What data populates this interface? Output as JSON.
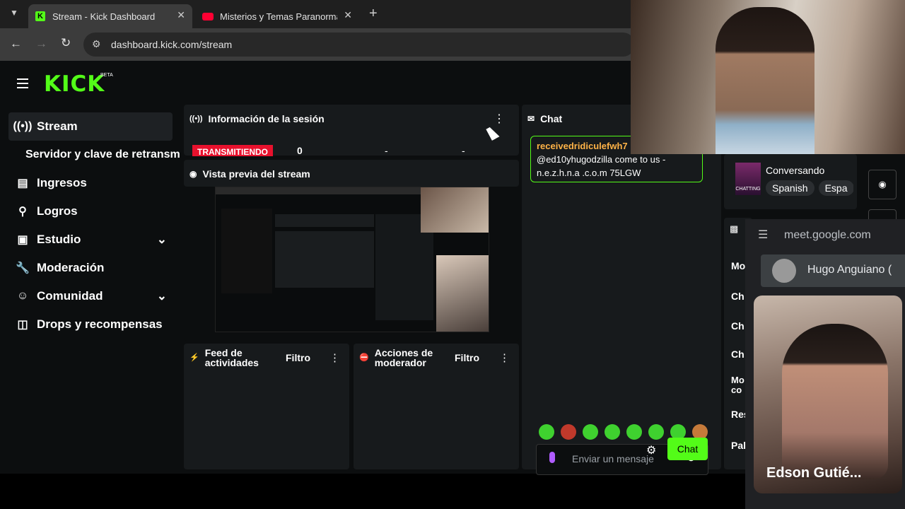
{
  "browser": {
    "tabs": [
      {
        "title": "Stream - Kick Dashboard",
        "active": true
      },
      {
        "title": "Misterios y Temas Paranormales",
        "active": false
      }
    ],
    "url": "dashboard.kick.com/stream"
  },
  "app": {
    "logo": "KICK",
    "logo_badge": "BETA",
    "sidebar": [
      {
        "label": "Stream",
        "icon": "broadcast-icon",
        "active": true
      },
      {
        "label": "Servidor y clave de retransm",
        "icon": "",
        "sub": true
      },
      {
        "label": "Ingresos",
        "icon": "chart-icon"
      },
      {
        "label": "Logros",
        "icon": "trophy-icon"
      },
      {
        "label": "Estudio",
        "icon": "studio-icon",
        "expand": true
      },
      {
        "label": "Moderación",
        "icon": "wrench-icon"
      },
      {
        "label": "Comunidad",
        "icon": "community-icon",
        "expand": true
      },
      {
        "label": "Drops y recompensas",
        "icon": "gift-icon"
      }
    ],
    "session": {
      "title": "Información de la sesión",
      "status": "TRANSMITIENDO",
      "viewers": "0",
      "stat2": "-",
      "stat3": "-"
    },
    "preview": {
      "title": "Vista previa del stream"
    },
    "feed": {
      "title": "Feed de actividades",
      "filter": "Filtro"
    },
    "modactions": {
      "title": "Acciones de moderador",
      "filter": "Filtro"
    },
    "chat": {
      "title": "Chat",
      "message_user": "receivedridiculefwh7",
      "message_text_1": "@ed10yhugodzilla come to us -",
      "message_text_2": "n.e.z.h.n.a .c.o.m 75LGW",
      "input_placeholder": "Enviar un mensaje",
      "send_label": "Chat"
    },
    "right_panel": {
      "category": "Conversando",
      "tags": [
        "Spanish",
        "Espa"
      ],
      "category_thumb": "CHATTING",
      "rows": [
        "Mo",
        "Ch",
        "Ch",
        "Ch",
        "Mo",
        "co",
        "Res",
        "Pal"
      ]
    }
  },
  "meet": {
    "domain": "meet.google.com",
    "participant_top": "Hugo Anguiano (",
    "participant_bottom": "Edson Gutié..."
  },
  "colors": {
    "kick_green": "#53fc18",
    "live_red": "#e8112d",
    "mic_purple": "#b05cff"
  }
}
